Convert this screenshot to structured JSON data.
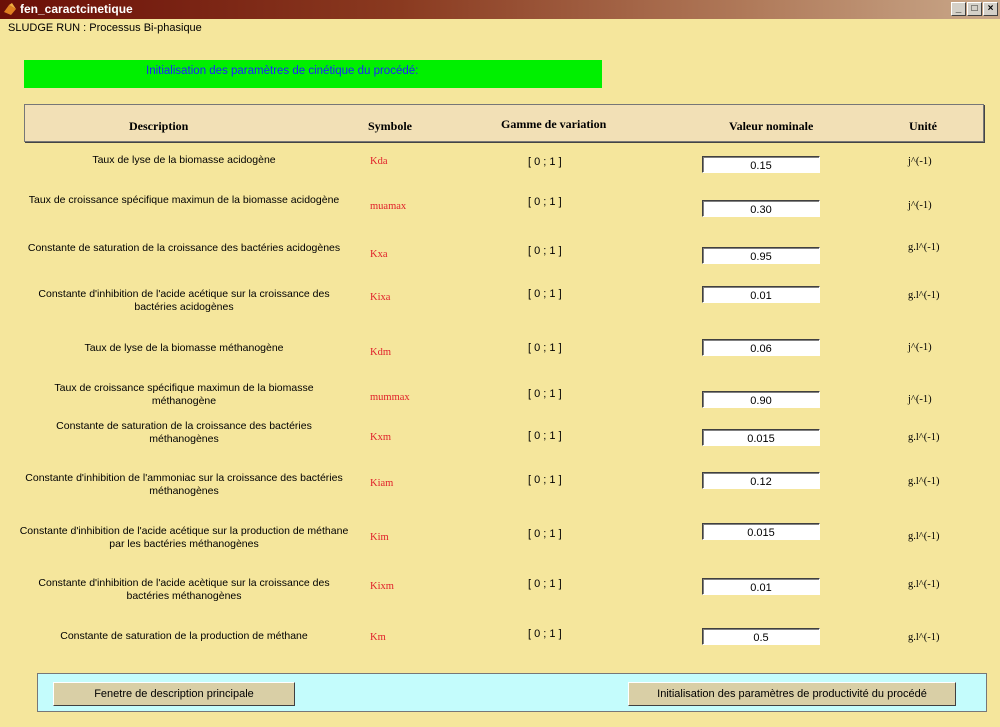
{
  "window": {
    "title": "fen_caractcinetique",
    "subtitle": "SLUDGE RUN : Processus Bi-phasique"
  },
  "banner": "Initialisation des paramètres de cinétique du procédé:",
  "headers": {
    "description": "Description",
    "symbole": "Symbole",
    "gamme": "Gamme de variation",
    "valeur": "Valeur nominale",
    "unite": "Unité"
  },
  "rows": [
    {
      "desc": "Taux de lyse de la biomasse acidogène",
      "sym": "Kda",
      "range": "[ 0 ; 1 ]",
      "value": "0.15",
      "unit": "j^(-1)"
    },
    {
      "desc": "Taux de croissance spécifique maximun de la biomasse acidogène",
      "sym": "muamax",
      "range": "[ 0 ; 1 ]",
      "value": "0.30",
      "unit": "j^(-1)"
    },
    {
      "desc": "Constante de saturation de la croissance des bactéries acidogènes",
      "sym": "Kxa",
      "range": "[ 0 ; 1 ]",
      "value": "0.95",
      "unit": "g.l^(-1)"
    },
    {
      "desc": "Constante d'inhibition de l'acide acétique sur la croissance des bactéries acidogènes",
      "sym": "Kixa",
      "range": "[ 0 ; 1 ]",
      "value": "0.01",
      "unit": "g.l^(-1)"
    },
    {
      "desc": "Taux de lyse de la biomasse méthanogène",
      "sym": "Kdm",
      "range": "[ 0 ; 1 ]",
      "value": "0.06",
      "unit": "j^(-1)"
    },
    {
      "desc": "Taux de croissance spécifique maximun de la biomasse méthanogène",
      "sym": "mummax",
      "range": "[ 0 ; 1 ]",
      "value": "0.90",
      "unit": "j^(-1)"
    },
    {
      "desc": "Constante de saturation de la croissance des bactéries méthanogènes",
      "sym": "Kxm",
      "range": "[ 0 ; 1 ]",
      "value": "0.015",
      "unit": "g.l^(-1)"
    },
    {
      "desc": "Constante d'inhibition de l'ammoniac sur la croissance des bactéries méthanogènes",
      "sym": "Kiam",
      "range": "[ 0 ; 1 ]",
      "value": "0.12",
      "unit": "g.l^(-1)"
    },
    {
      "desc": "Constante d'inhibition de l'acide acétique sur la production de méthane par les bactéries méthanogènes",
      "sym": "Kim",
      "range": "[ 0 ; 1 ]",
      "value": "0.015",
      "unit": "g.l^(-1)"
    },
    {
      "desc": "Constante d'inhibition de l'acide acètique sur la croissance des bactéries méthanogènes",
      "sym": "Kixm",
      "range": "[ 0 ; 1 ]",
      "value": "0.01",
      "unit": "g.l^(-1)"
    },
    {
      "desc": "Constante de saturation de la production de méthane",
      "sym": "Km",
      "range": "[ 0 ; 1 ]",
      "value": "0.5",
      "unit": "g.l^(-1)"
    }
  ],
  "buttons": {
    "main": "Fenetre de description principale",
    "productivity": "Initialisation des paramètres de productivité du procédé"
  },
  "colors": {
    "background": "#f5e69c",
    "banner": "#00f000",
    "symbol": "#e0202a",
    "footer": "#c4fcfc"
  }
}
